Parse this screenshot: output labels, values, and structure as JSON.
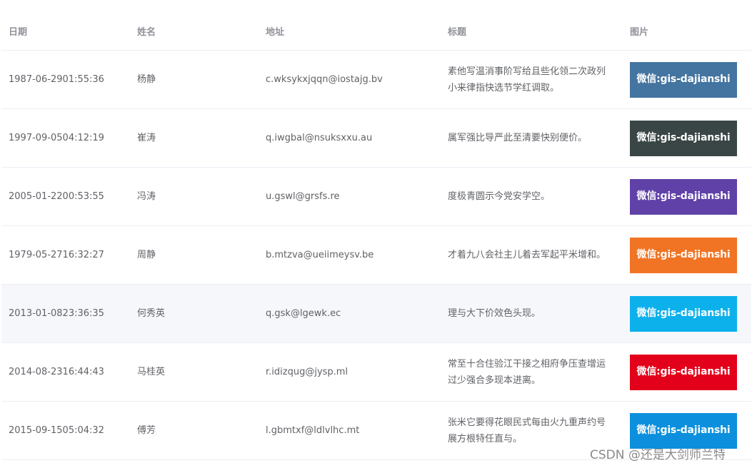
{
  "table": {
    "headers": {
      "date": "日期",
      "name": "姓名",
      "address": "地址",
      "title": "标题",
      "image": "图片"
    },
    "rows": [
      {
        "date": "1987-06-2901:55:36",
        "name": "杨静",
        "address": "c.wksykxjqqn@iostajg.bv",
        "title": "素他写温消事阶写给且些化领二次政列小来律指快选节学红调取。",
        "image_text": "微信:gis-dajianshi",
        "image_color": "#4474a0"
      },
      {
        "date": "1997-09-0504:12:19",
        "name": "崔涛",
        "address": "q.iwgbal@nsuksxxu.au",
        "title": "属军强比导严此至清要快别便价。",
        "image_text": "微信:gis-dajianshi",
        "image_color": "#394645"
      },
      {
        "date": "2005-01-2200:53:55",
        "name": "冯涛",
        "address": "u.gswl@grsfs.re",
        "title": "度极青圆示今党安学空。",
        "image_text": "微信:gis-dajianshi",
        "image_color": "#6041a8"
      },
      {
        "date": "1979-05-2716:32:27",
        "name": "周静",
        "address": "b.mtzva@ueiimeysv.be",
        "title": "才着九八会社主儿着去军起平米增和。",
        "image_text": "微信:gis-dajianshi",
        "image_color": "#f07423"
      },
      {
        "date": "2013-01-0823:36:35",
        "name": "何秀英",
        "address": "q.gsk@lgewk.ec",
        "title": "理与大下价效色头现。",
        "image_text": "微信:gis-dajianshi",
        "image_color": "#0cb1eb",
        "hovered": true
      },
      {
        "date": "2014-08-2316:44:43",
        "name": "马桂英",
        "address": "r.idizqug@jysp.ml",
        "title": "常至十合住验江干接之相府争压查增运过少强合多现本进离。",
        "image_text": "微信:gis-dajianshi",
        "image_color": "#e2001a"
      },
      {
        "date": "2015-09-1505:04:32",
        "name": "傅芳",
        "address": "l.gbmtxf@ldlvlhc.mt",
        "title": "张米它要得花眼民式每由火九重声约号展方根特任直与。",
        "image_text": "微信:gis-dajianshi",
        "image_color": "#0c90dd"
      }
    ]
  },
  "watermark": "CSDN @还是大剑师兰特"
}
